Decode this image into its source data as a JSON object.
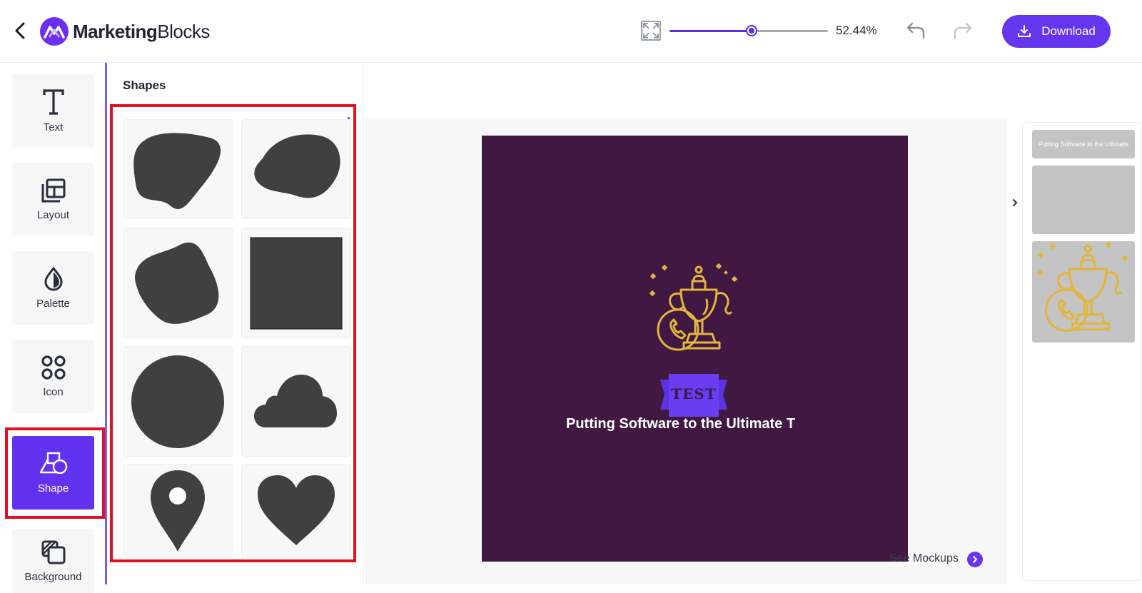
{
  "app": {
    "logo_bold": "Marketing",
    "logo_light": "Blocks"
  },
  "toolbar": {
    "zoom_value": "52.44%",
    "zoom_level": 0.52,
    "download_label": "Download"
  },
  "tools": [
    {
      "label": "Text",
      "icon": "text-icon"
    },
    {
      "label": "Layout",
      "icon": "layout-icon"
    },
    {
      "label": "Palette",
      "icon": "palette-icon"
    },
    {
      "label": "Icon",
      "icon": "icon-grid-icon"
    },
    {
      "label": "Shape",
      "icon": "shape-icon",
      "active": true
    },
    {
      "label": "Background",
      "icon": "background-icon"
    }
  ],
  "panel": {
    "title": "Shapes",
    "shapes": [
      "blob-1",
      "blob-2",
      "blob-3",
      "square",
      "circle",
      "cloud",
      "location-pin",
      "heart"
    ]
  },
  "canvas": {
    "background": "#401841",
    "badge_text": "TEST",
    "headline": "Putting Software to the Ultimate T",
    "icon": "trophy-phone-icon"
  },
  "mockups": {
    "label": "See Mockups"
  },
  "layers": {
    "items": [
      {
        "type": "text",
        "label": "Putting Software to the Ultimate"
      },
      {
        "type": "blank"
      },
      {
        "type": "icon",
        "icon": "trophy-phone-icon"
      }
    ]
  },
  "colors": {
    "accent": "#6636EE",
    "highlight": "#E3101D",
    "gold": "#E2B53B",
    "shape_fill": "#404040"
  }
}
